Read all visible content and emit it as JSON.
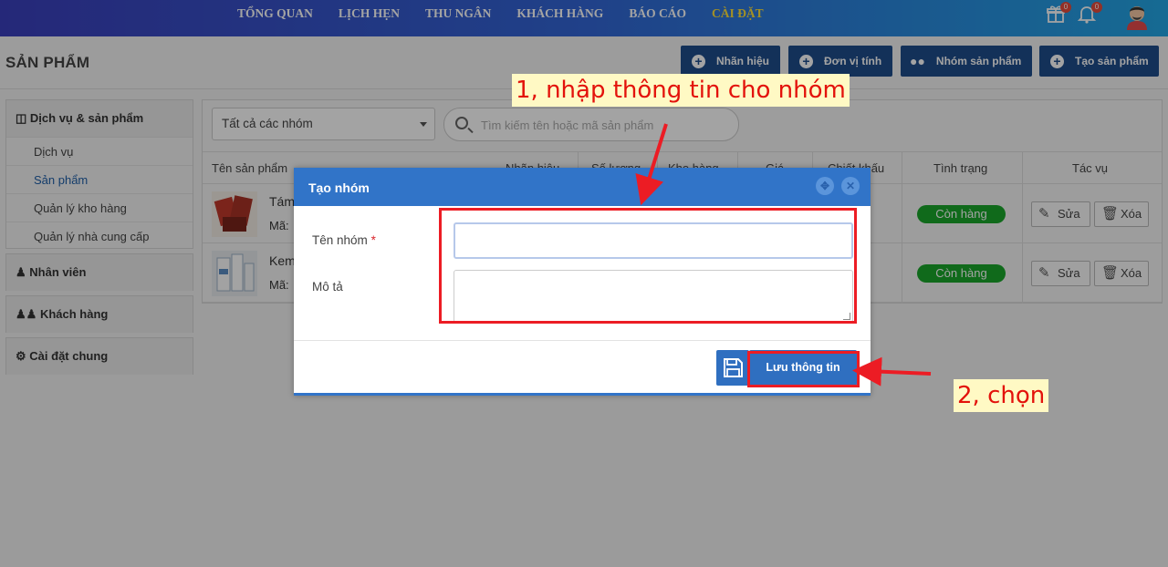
{
  "nav": {
    "items": [
      "TỔNG QUAN",
      "LỊCH HẸN",
      "THU NGÂN",
      "KHÁCH HÀNG",
      "BÁO CÁO",
      "CÀI ĐẶT"
    ],
    "active_index": 5,
    "gift_badge": "0",
    "bell_badge": "0"
  },
  "page": {
    "title": "SẢN PHẨM",
    "buttons": [
      "Nhãn hiệu",
      "Đơn vị tính",
      "Nhóm sản phẩm",
      "Tạo sản phẩm"
    ]
  },
  "sidebar": {
    "section1": "Dịch vụ & sản phẩm",
    "items": [
      "Dịch vụ",
      "Sản phẩm",
      "Quản lý kho hàng",
      "Quản lý nhà cung cấp"
    ],
    "active_item": "Sản phẩm",
    "section2": "Nhân viên",
    "section3": "Khách hàng",
    "section4": "Cài đặt chung"
  },
  "filters": {
    "group_select": "Tất cả các nhóm",
    "search_placeholder": "Tìm kiếm tên hoặc mã sản phẩm"
  },
  "table": {
    "headers": [
      "Tên sản phẩm",
      "Nhãn hiệu",
      "Số lượng",
      "Kho hàng",
      "Giá",
      "Chiết khấu",
      "Tình trạng",
      "Tác vụ"
    ],
    "rows": [
      {
        "name": "Tám",
        "code": "Mã:",
        "status": "Còn hàng",
        "edit": "Sửa",
        "delete": "Xóa"
      },
      {
        "name": "Kem",
        "code": "Mã:",
        "status": "Còn hàng",
        "edit": "Sửa",
        "delete": "Xóa"
      }
    ]
  },
  "modal": {
    "title": "Tạo nhóm",
    "name_label": "Tên nhóm",
    "required_mark": "*",
    "name_value": "",
    "desc_label": "Mô tả",
    "desc_value": "",
    "save_label": "Lưu thông tin"
  },
  "annotations": {
    "step1": "1, nhập thông tin cho nhóm",
    "step2": "2, chọn"
  },
  "colors": {
    "primary": "#1f4e8c",
    "modal_header": "#3174c8",
    "status_green": "#19a62b",
    "annotation_red": "#ec1c24",
    "nav_active": "#ffe23a"
  }
}
